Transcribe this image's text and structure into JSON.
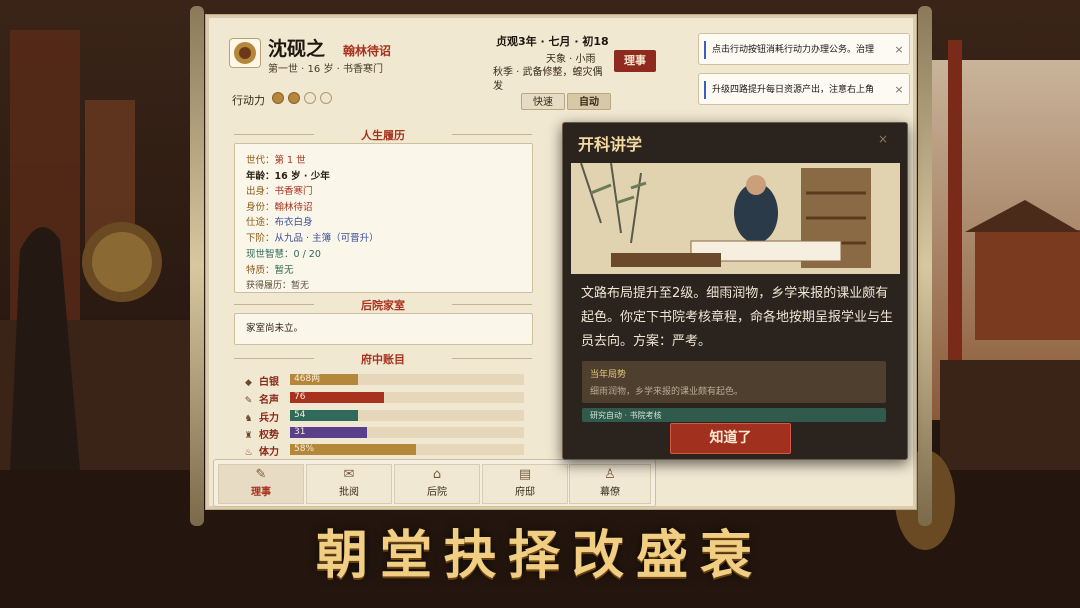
{
  "character": {
    "name": "沈砚之",
    "rank": "翰林待诏",
    "meta": "第一世 · 16 岁 · 书香寒门"
  },
  "action_points": {
    "label": "行动力",
    "filled": 2,
    "total": 4
  },
  "calendar": {
    "date": "贞观3年 · 七月 · 初18",
    "weather": "天象 · 小雨",
    "season": "秋季 · 武备修整，蝗灾偶发"
  },
  "buttons": {
    "manage": "理事",
    "fast": "快速",
    "auto": "自动"
  },
  "notices": [
    {
      "text": "点击行动按钮消耗行动力办理公务。治理"
    },
    {
      "text": "升级四路提升每日资源产出，注意右上角"
    }
  ],
  "life": {
    "title": "人生履历",
    "generation_k": "世代：",
    "generation_v": "第 1 世",
    "age_k": "年龄：",
    "age_v": "16 岁 · 少年",
    "origin_k": "出身：",
    "origin_v": "书香寒门",
    "identity_k": "身份：",
    "identity_v": "翰林待诏",
    "career_k": "仕途：",
    "career_v": "布衣白身",
    "next_k": "下阶：",
    "next_v": "从九品 · 主簿（可晋升）",
    "wisdom": "现世智慧：0 / 20",
    "trait_k": "特质：",
    "trait_v": "暂无",
    "history": "获得履历：暂无"
  },
  "household": {
    "title": "后院家室",
    "text": "家室尚未立。"
  },
  "accounts": {
    "title": "府中账目",
    "stats": [
      {
        "icon": "coin-icon",
        "glyph": "◆",
        "label": "白银",
        "value": "468两",
        "fraction": 0.29,
        "color": "#b5873a"
      },
      {
        "icon": "fame-icon",
        "glyph": "✎",
        "label": "名声",
        "value": "76",
        "fraction": 0.4,
        "color": "#a8321e"
      },
      {
        "icon": "soldier-icon",
        "glyph": "♞",
        "label": "兵力",
        "value": "54",
        "fraction": 0.29,
        "color": "#2f6a5a"
      },
      {
        "icon": "power-icon",
        "glyph": "♜",
        "label": "权势",
        "value": "31",
        "fraction": 0.33,
        "color": "#5a3f8a"
      },
      {
        "icon": "stamina-icon",
        "glyph": "♨",
        "label": "体力",
        "value": "58%",
        "fraction": 0.54,
        "color": "#b5873a"
      }
    ]
  },
  "tabs": [
    {
      "icon": "brush-icon",
      "glyph": "✎",
      "label": "理事",
      "active": true
    },
    {
      "icon": "scroll-icon",
      "glyph": "✉",
      "label": "批阅",
      "active": false
    },
    {
      "icon": "courtyard-icon",
      "glyph": "⌂",
      "label": "后院",
      "active": false
    },
    {
      "icon": "office-icon",
      "glyph": "▤",
      "label": "府邸",
      "active": false
    },
    {
      "icon": "staff-icon",
      "glyph": "♙",
      "label": "幕僚",
      "active": false
    }
  ],
  "modal": {
    "title": "开科讲学",
    "close": "×",
    "body": "文路布局提升至2级。细雨润物，乡学来报的课业颇有起色。你定下书院考核章程，命各地按期呈报学业与生员去向。方案：严考。",
    "card_title": "当年局势",
    "card_text": "细雨润物，乡学来报的课业颇有起色。",
    "card2_text": "研究自动 · 书院考核",
    "confirm": "知道了"
  },
  "headline": "朝堂抉择改盛衰",
  "colors": {
    "accent_red": "#a8321e",
    "gold": "#f0cf85",
    "paper": "#f1e8d2",
    "modal": "#2b231e"
  }
}
